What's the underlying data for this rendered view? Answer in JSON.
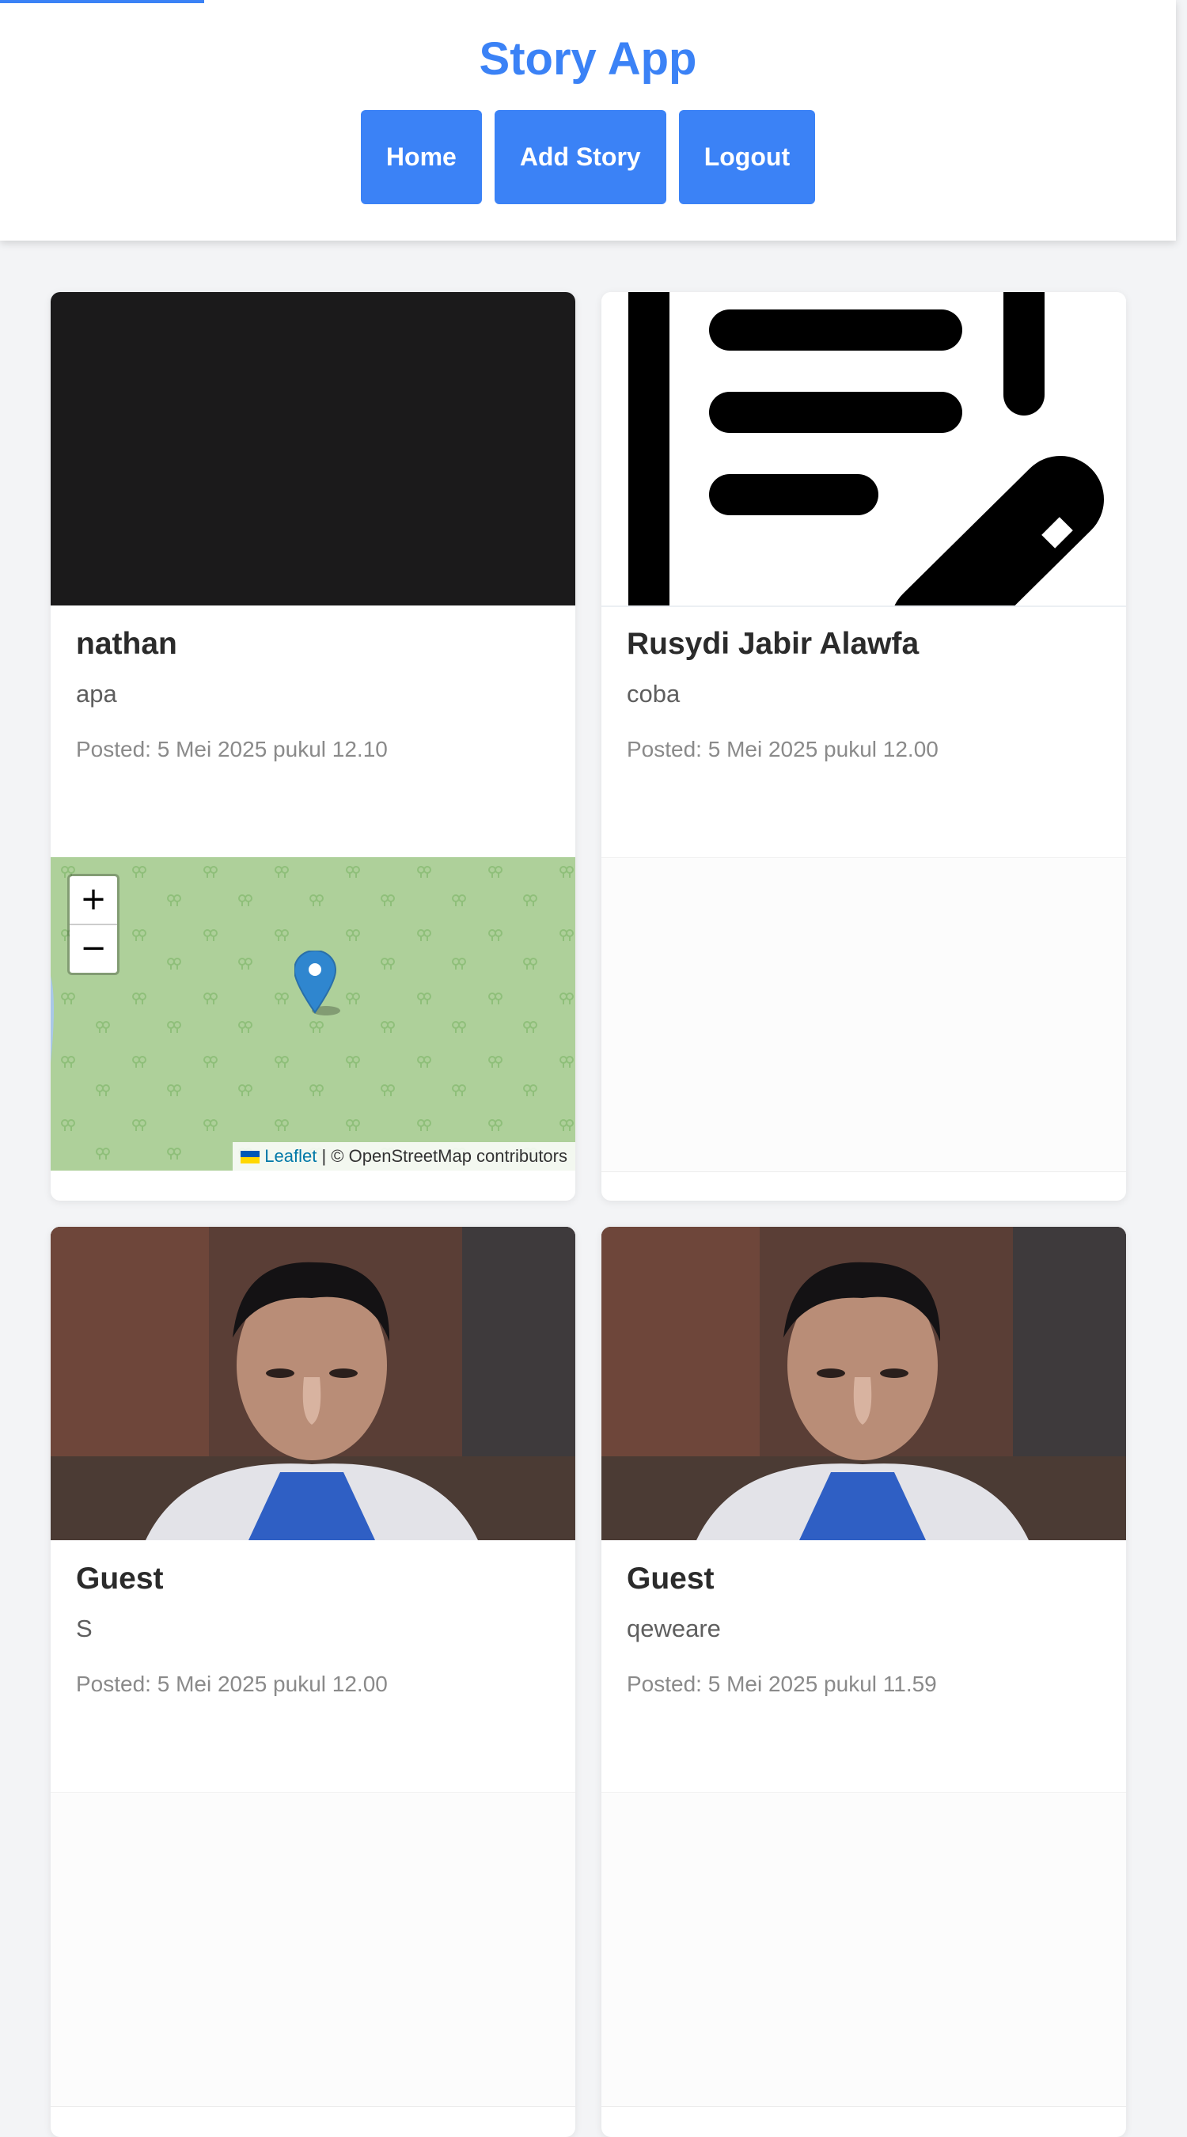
{
  "header": {
    "title": "Story App",
    "nav": [
      {
        "label": "Home"
      },
      {
        "label": "Add Story"
      },
      {
        "label": "Logout"
      }
    ]
  },
  "stories": [
    {
      "author": "nathan",
      "description": "apa",
      "posted": "Posted: 5 Mei 2025 pukul 12.10",
      "has_map": true
    },
    {
      "author": "Rusydi Jabir Alawfa",
      "description": "coba",
      "posted": "Posted: 5 Mei 2025 pukul 12.00",
      "has_map": false
    },
    {
      "author": "Guest",
      "description": "S",
      "posted": "Posted: 5 Mei 2025 pukul 12.00",
      "has_map": false
    },
    {
      "author": "Guest",
      "description": "qeweare",
      "posted": "Posted: 5 Mei 2025 pukul 11.59",
      "has_map": false
    }
  ],
  "map": {
    "zoom_in": "+",
    "zoom_out": "−",
    "attribution_link": "Leaflet",
    "attribution_text": "| © OpenStreetMap contributors"
  },
  "colors": {
    "accent": "#3b82f6",
    "page_background": "#f3f4f6",
    "map_green": "#aed09a"
  },
  "icons": {
    "marker": "map-marker-icon",
    "story_placeholder": "document-edit-icon"
  }
}
